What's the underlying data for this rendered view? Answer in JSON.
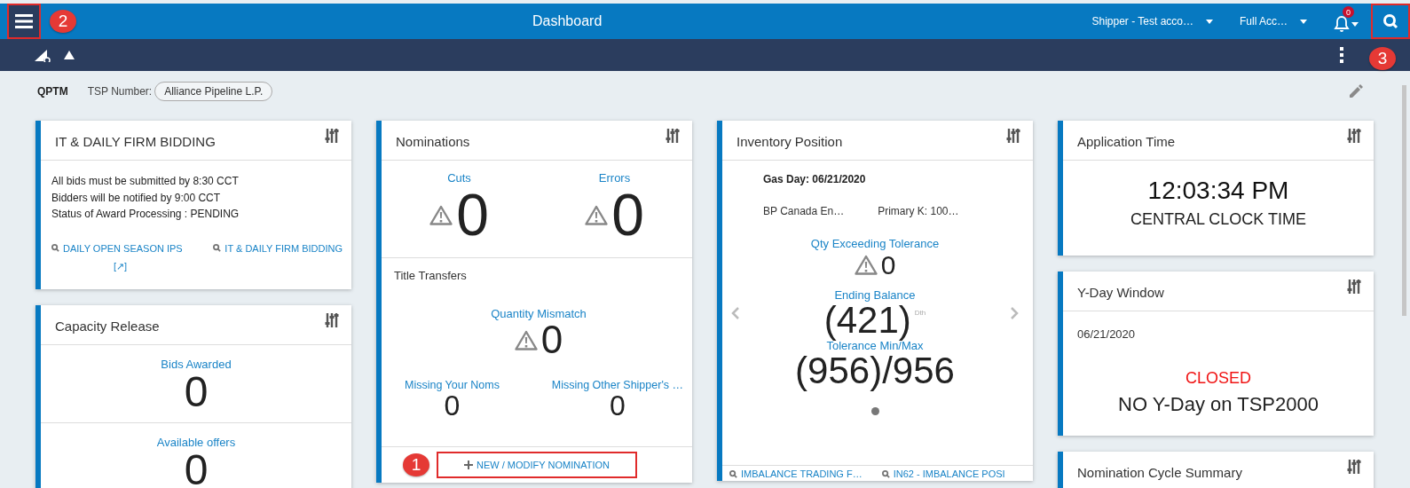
{
  "top_bar": {
    "title": "Dashboard",
    "account": "Shipper - Test acco…",
    "access": "Full Acc…",
    "notification_count": "0",
    "menu_highlighted": true,
    "search_highlighted": true
  },
  "annotations": [
    {
      "label": "1"
    },
    {
      "label": "2"
    },
    {
      "label": "3"
    }
  ],
  "info": {
    "code": "QPTM",
    "tsp_label": "TSP Number:",
    "tsp_value": "Alliance Pipeline L.P."
  },
  "bidding": {
    "title": "IT & DAILY FIRM BIDDING",
    "lines": [
      "All bids must be submitted by 8:30 CCT",
      "Bidders will be notified by 9:00 CCT",
      "Status of Award Processing : PENDING"
    ],
    "links": [
      "DAILY OPEN SEASON IPS",
      "IT & DAILY FIRM BIDDING"
    ],
    "external": "[↗]"
  },
  "capacity": {
    "title": "Capacity Release",
    "metrics": [
      {
        "label": "Bids Awarded",
        "value": "0"
      },
      {
        "label": "Available offers",
        "value": "0"
      }
    ]
  },
  "nominations": {
    "title": "Nominations",
    "metrics": [
      {
        "label": "Cuts",
        "value": "0",
        "warning": true
      },
      {
        "label": "Errors",
        "value": "0",
        "warning": true
      }
    ],
    "transfers_title": "Title Transfers",
    "mismatch": {
      "label": "Quantity Mismatch",
      "value": "0",
      "warning": true
    },
    "small_metrics": [
      {
        "label": "Missing Your Noms",
        "value": "0"
      },
      {
        "label": "Missing Other Shipper's …",
        "value": "0"
      }
    ],
    "action": {
      "label": "NEW / MODIFY NOMINATION",
      "highlighted": true
    }
  },
  "inventory": {
    "title": "Inventory Position",
    "gas_day": "Gas Day: 06/21/2020",
    "party": "BP Canada En…",
    "contract": "Primary K: 100…",
    "qty": {
      "label": "Qty Exceeding Tolerance",
      "value": "0",
      "warning": true
    },
    "balance": {
      "label": "Ending Balance",
      "value": "(421)",
      "unit": "Dth"
    },
    "tolerance": {
      "label": "Tolerance Min/Max",
      "value": "(956)/956"
    },
    "pages": [
      {
        "selected": true
      }
    ],
    "links": [
      "IMBALANCE TRADING F…",
      "IN62 - IMBALANCE POSI"
    ]
  },
  "app_time": {
    "title": "Application Time",
    "time": "12:03:34 PM",
    "caption": "CENTRAL CLOCK TIME"
  },
  "yday": {
    "title": "Y-Day Window",
    "date": "06/21/2020",
    "status": "CLOSED",
    "message": "NO Y-Day on TSP2000"
  },
  "cycle": {
    "title": "Nomination Cycle Summary"
  }
}
